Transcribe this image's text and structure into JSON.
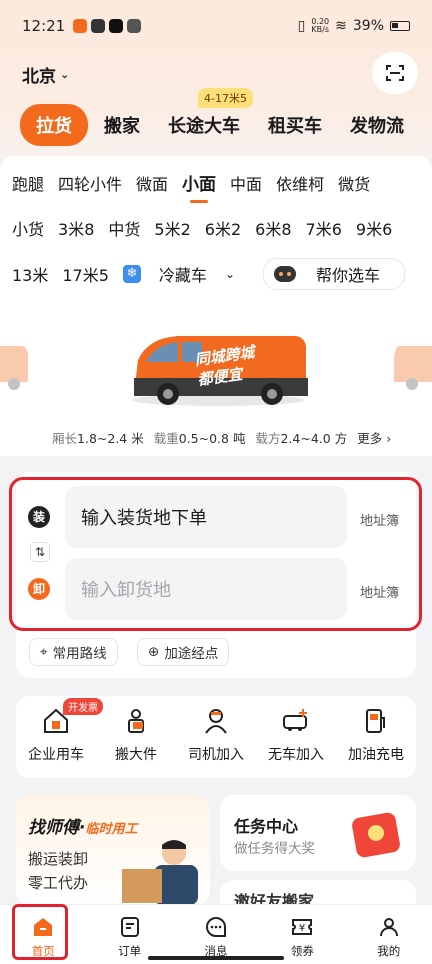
{
  "status_bar": {
    "time": "12:21",
    "net_speed_top": "0.20",
    "net_speed_bottom": "KB/s",
    "battery": "39%"
  },
  "header": {
    "city": "北京",
    "main_tabs": [
      "拉货",
      "搬家",
      "长途大车",
      "租买车",
      "发物流"
    ],
    "tab_badge": "4-17米5"
  },
  "vehicles": {
    "row1": [
      "跑腿",
      "四轮小件",
      "微面",
      "小面",
      "中面",
      "依维柯",
      "微货"
    ],
    "row2": [
      "小货",
      "3米8",
      "中货",
      "5米2",
      "6米2",
      "6米8",
      "7米6",
      "9米6"
    ],
    "row3": [
      "13米",
      "17米5"
    ],
    "cold_chip": "冷藏车",
    "pick_chip": "帮你选车",
    "selected": "小面",
    "van_banner": "同城跨城\n都便宜"
  },
  "specs": {
    "length_label": "厢长",
    "length": "1.8~2.4 米",
    "load_label": "载重",
    "load": "0.5~0.8 吨",
    "volume_label": "载方",
    "volume": "2.4~4.0 方",
    "more": "更多"
  },
  "address": {
    "load_dot": "装",
    "unload_dot": "卸",
    "load_value": "输入装货地下单",
    "unload_placeholder": "输入卸货地",
    "book": "地址簿",
    "common_route": "常用路线",
    "add_stop": "加途经点"
  },
  "services": [
    {
      "label": "企业用车",
      "badge": "开发票"
    },
    {
      "label": "搬大件"
    },
    {
      "label": "司机加入"
    },
    {
      "label": "无车加入"
    },
    {
      "label": "加油充电"
    }
  ],
  "promos": {
    "left_title": "找师傅·",
    "left_title_tag": "临时用工",
    "left_sub": "搬运装卸\n零工代办",
    "task_title": "任务中心",
    "task_sub": "做任务得大奖",
    "second_title": "邀好友搬家"
  },
  "bottom_nav": [
    "首页",
    "订单",
    "消息",
    "领券",
    "我的"
  ],
  "colors": {
    "accent": "#f36a1d",
    "highlight_outline": "#e0232e"
  }
}
